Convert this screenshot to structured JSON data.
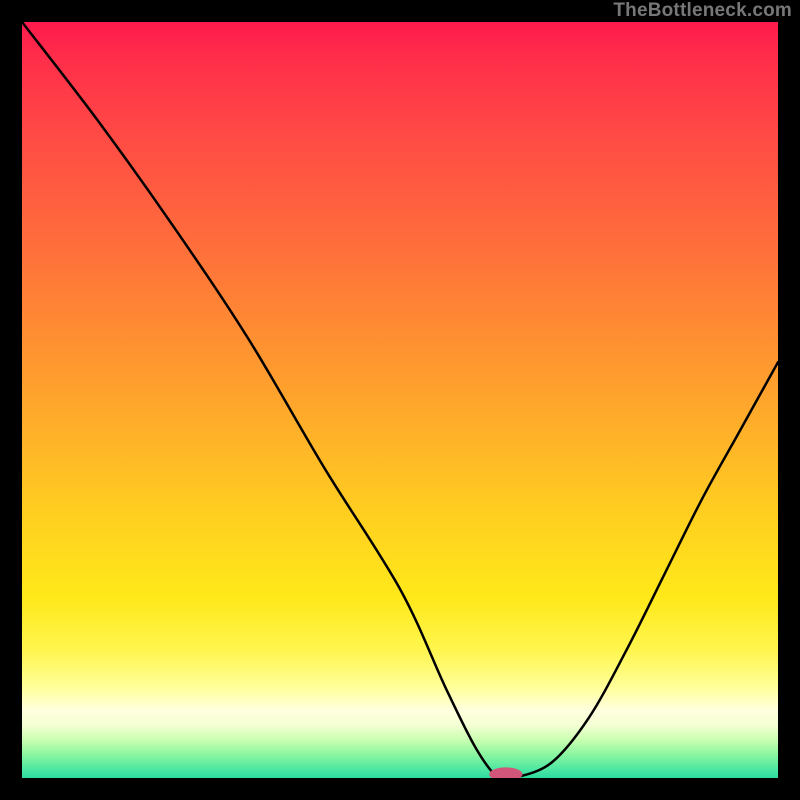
{
  "watermark": "TheBottleneck.com",
  "chart_data": {
    "type": "line",
    "title": "",
    "xlabel": "",
    "ylabel": "",
    "xlim": [
      0,
      100
    ],
    "ylim": [
      0,
      100
    ],
    "grid": false,
    "axes": false,
    "series": [
      {
        "name": "curve",
        "x": [
          0,
          10,
          20,
          30,
          40,
          50,
          56,
          60,
          63,
          65,
          70,
          75,
          80,
          85,
          90,
          95,
          100
        ],
        "y": [
          100,
          87,
          73,
          58,
          41,
          25,
          12,
          4,
          0,
          0,
          2,
          8,
          17,
          27,
          37,
          46,
          55
        ]
      }
    ],
    "marker": {
      "name": "optimal-marker",
      "x": 64,
      "y": 0.5,
      "rx": 2.2,
      "ry": 0.9,
      "fill": "#d1567a"
    },
    "background_gradient": {
      "top": "#ff1a4d",
      "mid": "#ffd11f",
      "bottom": "#2ddc9d"
    }
  }
}
